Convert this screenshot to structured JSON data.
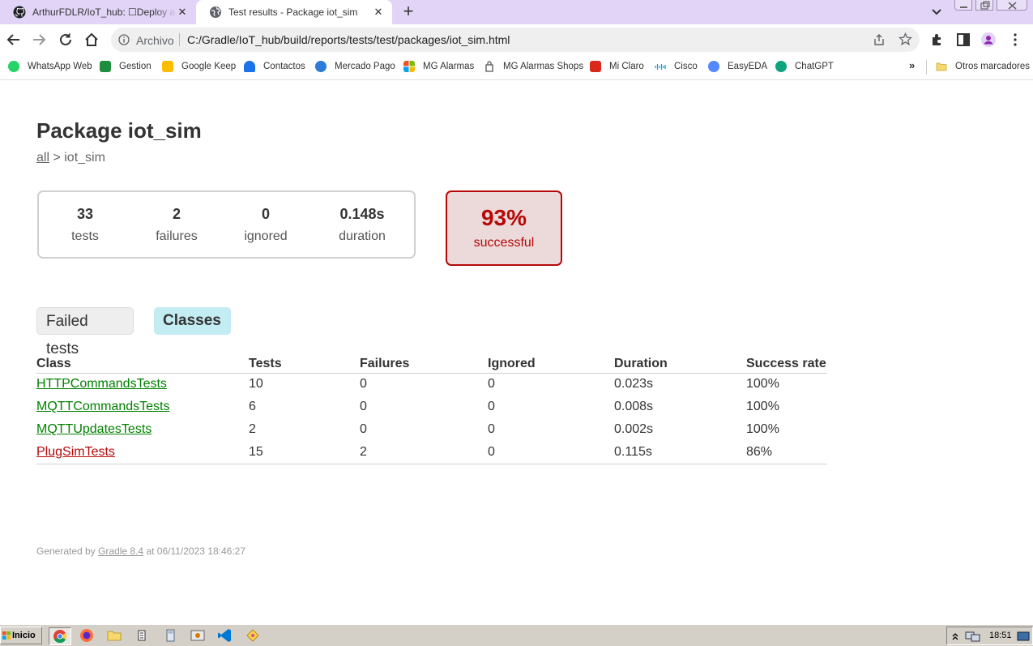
{
  "browser": {
    "tabs": [
      {
        "title": "ArthurFDLR/IoT_hub: ☐Deploy a se",
        "favicon": "github-icon"
      },
      {
        "title": "Test results - Package iot_sim",
        "favicon": "globe-icon"
      }
    ],
    "omnibox": {
      "label": "Archivo",
      "url": "C:/Gradle/IoT_hub/build/reports/tests/test/packages/iot_sim.html"
    },
    "bookmarks": [
      {
        "label": "WhatsApp Web",
        "icon": "whatsapp-icon",
        "color": "#25d366"
      },
      {
        "label": "Gestion",
        "icon": "sheets-icon",
        "color": "#1e8e3e"
      },
      {
        "label": "Google Keep",
        "icon": "keep-icon",
        "color": "#fbbc04"
      },
      {
        "label": "Contactos",
        "icon": "contacts-icon",
        "color": "#1a73e8"
      },
      {
        "label": "Mercado Pago",
        "icon": "mercadopago-icon",
        "color": "#2d7bd6"
      },
      {
        "label": "MG Alarmas",
        "icon": "microsoft-icon",
        "color": "#f25022"
      },
      {
        "label": "MG Alarmas Shops",
        "icon": "bag-icon",
        "color": "#555555"
      },
      {
        "label": "Mi Claro",
        "icon": "claro-icon",
        "color": "#da291c"
      },
      {
        "label": "Cisco",
        "icon": "cisco-icon",
        "color": "#049fd9"
      },
      {
        "label": "EasyEDA",
        "icon": "easyeda-icon",
        "color": "#5588ff"
      },
      {
        "label": "ChatGPT",
        "icon": "chatgpt-icon",
        "color": "#10a37f"
      }
    ],
    "bookmarks_more": "»",
    "other_bookmarks": "Otros marcadores"
  },
  "page": {
    "title": "Package iot_sim",
    "breadcrumb": {
      "link": "all",
      "separator": " > ",
      "current": "iot_sim"
    },
    "summary": {
      "tests": {
        "value": "33",
        "label": "tests"
      },
      "failures": {
        "value": "2",
        "label": "failures"
      },
      "ignored": {
        "value": "0",
        "label": "ignored"
      },
      "duration": {
        "value": "0.148s",
        "label": "duration"
      }
    },
    "success": {
      "value": "93%",
      "label": "successful"
    },
    "tabs": {
      "failed": "Failed tests",
      "classes": "Classes"
    },
    "table": {
      "headers": [
        "Class",
        "Tests",
        "Failures",
        "Ignored",
        "Duration",
        "Success rate"
      ],
      "rows": [
        {
          "class": "HTTPCommandsTests",
          "tests": "10",
          "failures": "0",
          "ignored": "0",
          "duration": "0.023s",
          "rate": "100%",
          "status": "success"
        },
        {
          "class": "MQTTCommandsTests",
          "tests": "6",
          "failures": "0",
          "ignored": "0",
          "duration": "0.008s",
          "rate": "100%",
          "status": "success"
        },
        {
          "class": "MQTTUpdatesTests",
          "tests": "2",
          "failures": "0",
          "ignored": "0",
          "duration": "0.002s",
          "rate": "100%",
          "status": "success"
        },
        {
          "class": "PlugSimTests",
          "tests": "15",
          "failures": "2",
          "ignored": "0",
          "duration": "0.115s",
          "rate": "86%",
          "status": "failure"
        }
      ]
    },
    "footer": {
      "prefix": "Generated by ",
      "link": "Gradle 8.4",
      "suffix": " at 06/11/2023 18:46:27"
    }
  },
  "taskbar": {
    "start": "Inicio",
    "clock": "18:51"
  },
  "colors": {
    "success": "#008000",
    "failure": "#b60808",
    "success_box_bg": "#ecdada",
    "active_tab": "#c3ecf3"
  }
}
